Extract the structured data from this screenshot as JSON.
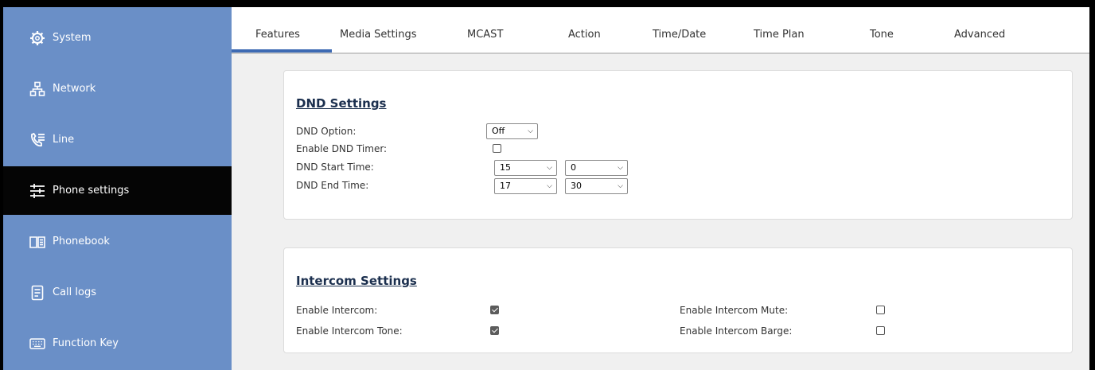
{
  "sidebar": {
    "items": [
      {
        "label": "System",
        "icon": "gear-icon"
      },
      {
        "label": "Network",
        "icon": "network-icon"
      },
      {
        "label": "Line",
        "icon": "phone-line-icon"
      },
      {
        "label": "Phone settings",
        "icon": "sliders-icon",
        "active": true
      },
      {
        "label": "Phonebook",
        "icon": "book-icon"
      },
      {
        "label": "Call logs",
        "icon": "document-icon"
      },
      {
        "label": "Function Key",
        "icon": "keyboard-icon"
      }
    ]
  },
  "tabs": [
    {
      "label": "Features",
      "active": true
    },
    {
      "label": "Media Settings"
    },
    {
      "label": "MCAST"
    },
    {
      "label": "Action"
    },
    {
      "label": "Time/Date"
    },
    {
      "label": "Time Plan"
    },
    {
      "label": "Tone"
    },
    {
      "label": "Advanced"
    }
  ],
  "dnd": {
    "title": "DND Settings",
    "option_label": "DND Option:",
    "option_value": "Off",
    "timer_label": "Enable DND Timer:",
    "timer_checked": false,
    "start_label": "DND Start Time:",
    "start_hour": "15",
    "start_minute": "0",
    "end_label": "DND End Time:",
    "end_hour": "17",
    "end_minute": "30"
  },
  "intercom": {
    "title": "Intercom Settings",
    "enable_label": "Enable Intercom:",
    "enable_checked": true,
    "tone_label": "Enable Intercom Tone:",
    "tone_checked": true,
    "mute_label": "Enable Intercom Mute:",
    "mute_checked": false,
    "barge_label": "Enable Intercom Barge:",
    "barge_checked": false
  },
  "colors": {
    "sidebar_bg": "#6a8fc7",
    "sidebar_active_bg": "#050505",
    "tab_accent": "#3d6ab3"
  }
}
